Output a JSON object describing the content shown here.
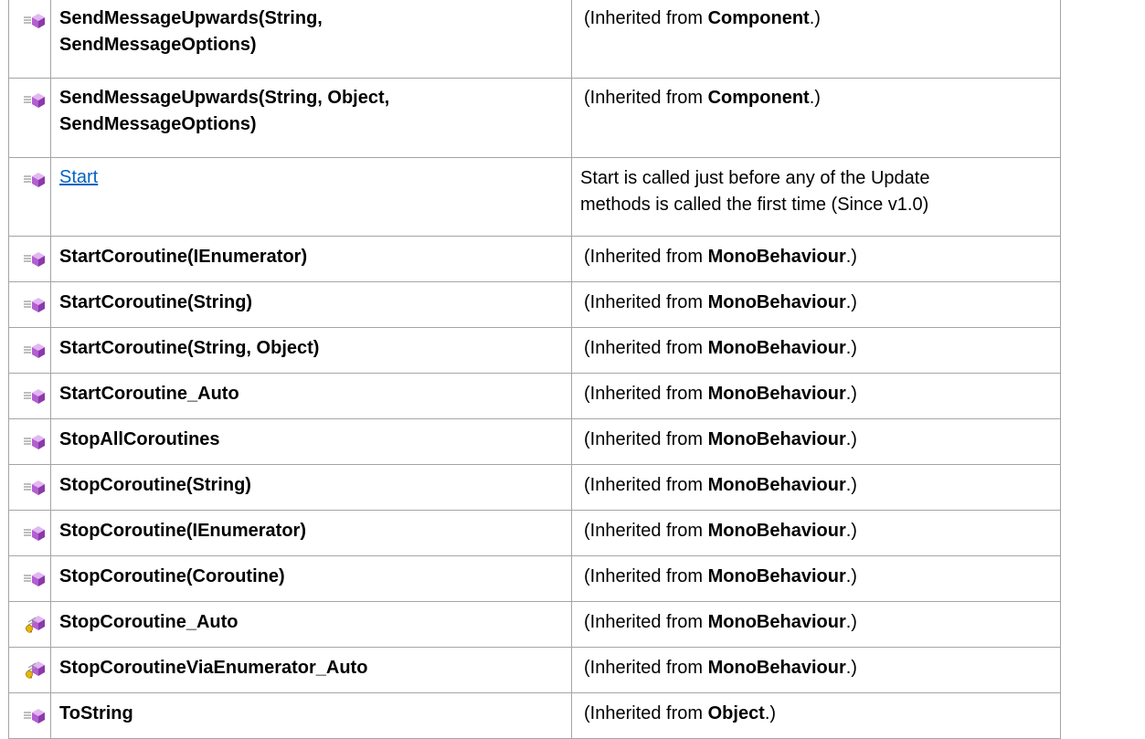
{
  "inherited_prefix": "(Inherited from ",
  "inherited_suffix": ".)",
  "rows": [
    {
      "name_line1": "SendMessageUpwards(String,",
      "name_line2": "SendMessageOptions)",
      "icon": "public-method-icon",
      "inherited_from": "Component"
    },
    {
      "name_line1": "SendMessageUpwards(String, Object,",
      "name_line2": "SendMessageOptions)",
      "icon": "public-method-icon",
      "inherited_from": "Component"
    },
    {
      "name": "Start",
      "icon": "public-method-icon",
      "description_line1": "Start is called just before any of the Update",
      "description_line2": "methods is called the first time (Since v1.0)"
    },
    {
      "name": "StartCoroutine(IEnumerator)",
      "icon": "public-method-icon",
      "inherited_from": "MonoBehaviour"
    },
    {
      "name": "StartCoroutine(String)",
      "icon": "public-method-icon",
      "inherited_from": "MonoBehaviour"
    },
    {
      "name": "StartCoroutine(String, Object)",
      "icon": "public-method-icon",
      "inherited_from": "MonoBehaviour"
    },
    {
      "name": "StartCoroutine_Auto",
      "icon": "public-method-icon",
      "inherited_from": "MonoBehaviour"
    },
    {
      "name": "StopAllCoroutines",
      "icon": "public-method-icon",
      "inherited_from": "MonoBehaviour"
    },
    {
      "name": "StopCoroutine(String)",
      "icon": "public-method-icon",
      "inherited_from": "MonoBehaviour"
    },
    {
      "name": "StopCoroutine(IEnumerator)",
      "icon": "public-method-icon",
      "inherited_from": "MonoBehaviour"
    },
    {
      "name": "StopCoroutine(Coroutine)",
      "icon": "public-method-icon",
      "inherited_from": "MonoBehaviour"
    },
    {
      "name": "StopCoroutine_Auto",
      "icon": "private-method-icon",
      "inherited_from": "MonoBehaviour"
    },
    {
      "name": "StopCoroutineViaEnumerator_Auto",
      "icon": "private-method-icon",
      "inherited_from": "MonoBehaviour"
    },
    {
      "name": "ToString",
      "icon": "public-method-icon",
      "inherited_from": "Object"
    }
  ],
  "colors": {
    "border": "#a5a5a5",
    "link": "#0563c1",
    "icon_cube": "#b35fd1",
    "icon_key": "#e7b50e"
  }
}
